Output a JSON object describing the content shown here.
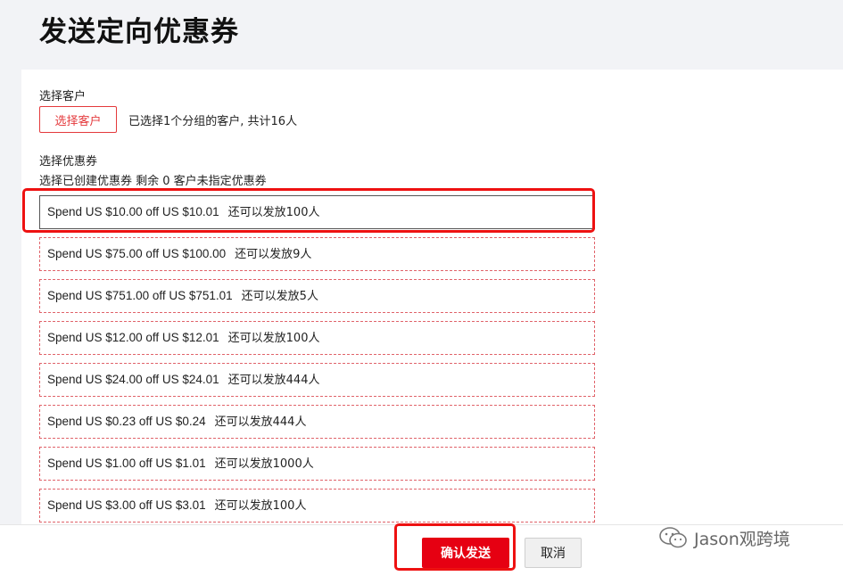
{
  "page": {
    "title": "发送定向优惠券"
  },
  "customer": {
    "section_label": "选择客户",
    "button_label": "选择客户",
    "selection_info": "已选择1个分组的客户, 共计16人"
  },
  "coupons": {
    "section_label": "选择优惠券",
    "sub_label": "选择已创建优惠券 剩余 0 客户未指定优惠券",
    "items": [
      {
        "name": "Spend US $10.00 off US $10.01",
        "remain": "还可以发放100人"
      },
      {
        "name": "Spend US $75.00 off US $100.00",
        "remain": "还可以发放9人"
      },
      {
        "name": "Spend US $751.00 off US $751.01",
        "remain": "还可以发放5人"
      },
      {
        "name": "Spend US $12.00 off US $12.01",
        "remain": "还可以发放100人"
      },
      {
        "name": "Spend US $24.00 off US $24.01",
        "remain": "还可以发放444人"
      },
      {
        "name": "Spend US $0.23 off US $0.24",
        "remain": "还可以发放444人"
      },
      {
        "name": "Spend US $1.00 off US $1.01",
        "remain": "还可以发放1000人"
      },
      {
        "name": "Spend US $3.00 off US $3.01",
        "remain": "还可以发放100人"
      }
    ]
  },
  "footer": {
    "confirm_label": "确认发送",
    "cancel_label": "取消"
  },
  "watermark": {
    "text": "Jason观跨境",
    "icon": "wechat-icon"
  },
  "colors": {
    "accent": "#e60012",
    "highlight": "#ee1111",
    "dashed_border": "#e0636a"
  }
}
